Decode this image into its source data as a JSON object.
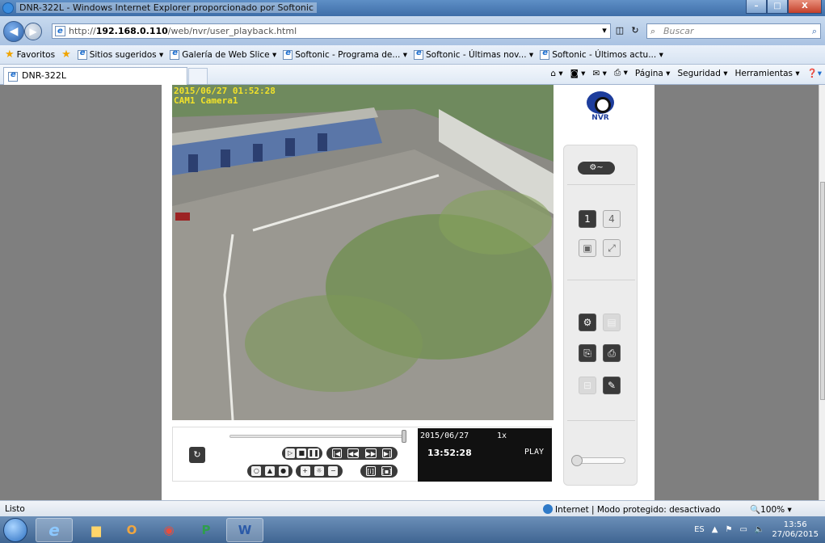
{
  "window": {
    "title": "DNR-322L - Windows Internet Explorer proporcionado por Softonic",
    "minimize": "–",
    "maximize": "□",
    "close": "X"
  },
  "address": {
    "url_prefix": "http://",
    "url_host": "192.168.0.110",
    "url_path": "/web/nvr/user_playback.html",
    "search_placeholder": "Buscar"
  },
  "favorites": {
    "label": "Favoritos",
    "items": [
      "Sitios sugeridos ▾",
      "Galería de Web Slice ▾",
      "Softonic - Programa de... ▾",
      "Softonic - Últimas nov... ▾",
      "Softonic - Últimos actu... ▾"
    ]
  },
  "tabs": {
    "active": "DNR-322L"
  },
  "commandbar": {
    "page": "Página ▾",
    "security": "Seguridad ▾",
    "tools": "Herramientas ▾"
  },
  "camera": {
    "date_overlay": "2015/06/27 01:52:28",
    "name_overlay": "CAM1 Camera1"
  },
  "logo": {
    "text": "NVR"
  },
  "playback": {
    "date": "2015/06/27",
    "speed": "1x",
    "time": "13:52:28",
    "state": "PLAY"
  },
  "statusbar": {
    "status": "Listo",
    "zone": "Internet | Modo protegido: desactivado",
    "zoom": "100%"
  },
  "taskbar": {
    "lang": "ES",
    "time": "13:56",
    "date": "27/06/2015"
  },
  "colors": {
    "overlay_text": "#f2e22a",
    "logo_blue": "#1d3d9c",
    "control_dark": "#3a3a3a"
  }
}
